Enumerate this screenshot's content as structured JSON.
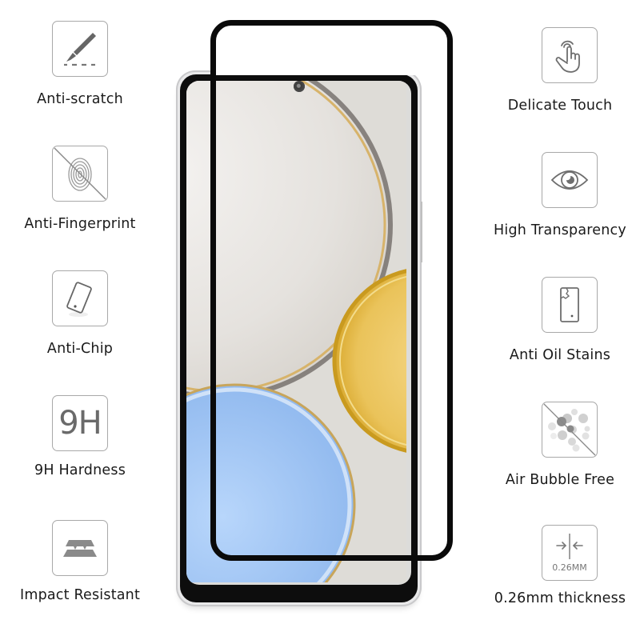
{
  "features_left": [
    {
      "icon": "scalpel-scratch-icon",
      "label": "Anti-scratch"
    },
    {
      "icon": "fingerprint-crossed-icon",
      "label": "Anti-Fingerprint"
    },
    {
      "icon": "tilted-phone-icon",
      "label": "Anti-Chip"
    },
    {
      "icon": "9h-text-icon",
      "label": "9H Hardness",
      "icon_text": "9H"
    },
    {
      "icon": "layers-impact-icon",
      "label": "Impact Resistant"
    }
  ],
  "features_right": [
    {
      "icon": "touch-hand-icon",
      "label": "Delicate Touch"
    },
    {
      "icon": "eye-icon",
      "label": "High Transparency"
    },
    {
      "icon": "phone-stain-icon",
      "label": "Anti Oil Stains"
    },
    {
      "icon": "bubbles-crossed-icon",
      "label": "Air Bubble Free"
    },
    {
      "icon": "thickness-arrows-icon",
      "label": "0.26mm thickness",
      "icon_text": "0.26MM"
    }
  ],
  "colors": {
    "icon_stroke": "#6e6e6e",
    "icon_border": "#a8a8a8",
    "protector_edge": "#0a0a0a",
    "wallpaper_gold": "#e8c35a",
    "wallpaper_blue": "#9ec3f2",
    "wallpaper_silver": "#e4e2de"
  }
}
